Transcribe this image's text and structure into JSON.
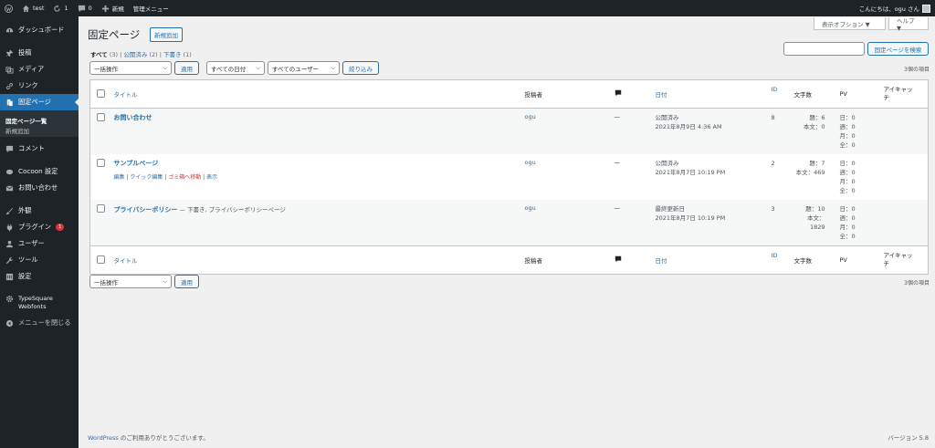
{
  "adminbar": {
    "site": "test",
    "updates": "1",
    "comments": "0",
    "new_label": "新規",
    "admin_menu": "管理メニュー",
    "greeting": "こんにちは、ogu さん"
  },
  "sidebar": {
    "items": [
      {
        "label": "ダッシュボード",
        "icon": "dashboard-icon"
      },
      {
        "label": "投稿",
        "icon": "pin-icon"
      },
      {
        "label": "メディア",
        "icon": "media-icon"
      },
      {
        "label": "リンク",
        "icon": "link-icon"
      },
      {
        "label": "固定ページ",
        "icon": "page-icon"
      },
      {
        "label": "コメント",
        "icon": "comment-icon"
      },
      {
        "label": "Cocoon 設定",
        "icon": "cocoon-icon"
      },
      {
        "label": "お問い合わせ",
        "icon": "mail-icon"
      },
      {
        "label": "外観",
        "icon": "brush-icon"
      },
      {
        "label": "プラグイン",
        "icon": "plugin-icon",
        "badge": "1"
      },
      {
        "label": "ユーザー",
        "icon": "user-icon"
      },
      {
        "label": "ツール",
        "icon": "wrench-icon"
      },
      {
        "label": "設定",
        "icon": "settings-icon"
      },
      {
        "label": "TypeSquare Webfonts",
        "icon": "gear-icon"
      },
      {
        "label": "メニューを閉じる",
        "icon": "collapse-icon"
      }
    ],
    "submenu": [
      "固定ページ一覧",
      "新規追加"
    ]
  },
  "header": {
    "screen_options": "表示オプション ▼",
    "help": "ヘルプ ▼",
    "title": "固定ページ",
    "add_new": "新規追加"
  },
  "subsub": {
    "all": "すべて",
    "all_count": "(3)",
    "published": "公開済み",
    "published_count": "(2)",
    "draft": "下書き",
    "draft_count": "(1)"
  },
  "search": {
    "button": "固定ページを検索",
    "value": ""
  },
  "filters": {
    "bulk": "一括操作",
    "apply": "適用",
    "dates": "すべての日付",
    "users": "すべてのユーザー",
    "filter": "絞り込み",
    "count": "3個の項目"
  },
  "table": {
    "columns": [
      "タイトル",
      "投稿者",
      "ID",
      "日付",
      "文字数",
      "PV",
      "アイキャッ",
      "チ"
    ],
    "rows": [
      {
        "title": "お問い合わせ",
        "state": "",
        "author": "ogu",
        "comments": "—",
        "date_status": "公開済み",
        "date": "2021年8月9日 4:36 AM",
        "id": "8",
        "chars": [
          "題：6",
          "本文：0"
        ],
        "pv": [
          "日：0",
          "週：0",
          "月：0",
          "全：0"
        ],
        "actions": []
      },
      {
        "title": "サンプルページ",
        "state": "",
        "author": "ogu",
        "comments": "—",
        "date_status": "公開済み",
        "date": "2021年8月7日 10:19 PM",
        "id": "2",
        "chars": [
          "題：7",
          "本文：469"
        ],
        "pv": [
          "日：0",
          "週：0",
          "月：0",
          "全：0"
        ],
        "actions": [
          "編集",
          "クイック編集",
          "ゴミ箱へ移動",
          "表示"
        ]
      },
      {
        "title": "プライバシーポリシー",
        "state": " — 下書き, プライバシーポリシーページ",
        "author": "ogu",
        "comments": "—",
        "date_status": "最終更新日",
        "date": "2021年8月7日 10:19 PM",
        "id": "3",
        "chars": [
          "題：10",
          "本文：1829"
        ],
        "pv": [
          "日：0",
          "週：0",
          "月：0",
          "全：0"
        ],
        "actions": []
      }
    ]
  },
  "footer": {
    "wp": "WordPress",
    "text": " のご利用ありがとうございます。",
    "version": "バージョン 5.8"
  }
}
